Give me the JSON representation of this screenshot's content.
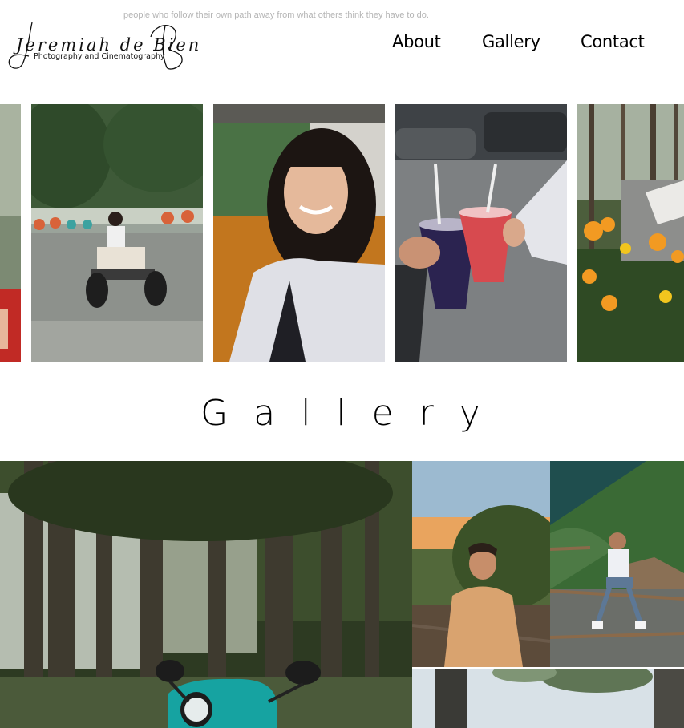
{
  "header": {
    "tagline": "people who follow their own path away from what others think they have to do.",
    "logo_script": "Jeremiah de Bien",
    "logo_subtitle": "Photography and Cinematography"
  },
  "nav": {
    "items": [
      {
        "label": "About"
      },
      {
        "label": "Gallery"
      },
      {
        "label": "Contact"
      }
    ]
  },
  "carousel": {
    "slides": [
      {
        "subject": "partial portrait in red"
      },
      {
        "subject": "girl on go-kart in park"
      },
      {
        "subject": "smiling girl portrait"
      },
      {
        "subject": "two iced drinks toast"
      },
      {
        "subject": "garden with orange flowers"
      }
    ]
  },
  "gallery": {
    "heading": "Gallery",
    "items": [
      {
        "subject": "teal scooter under trees"
      },
      {
        "subject": "man in tan shirt at sunset"
      },
      {
        "subject": "young man sitting on fence"
      },
      {
        "subject": "tree trunks against sky"
      }
    ]
  }
}
